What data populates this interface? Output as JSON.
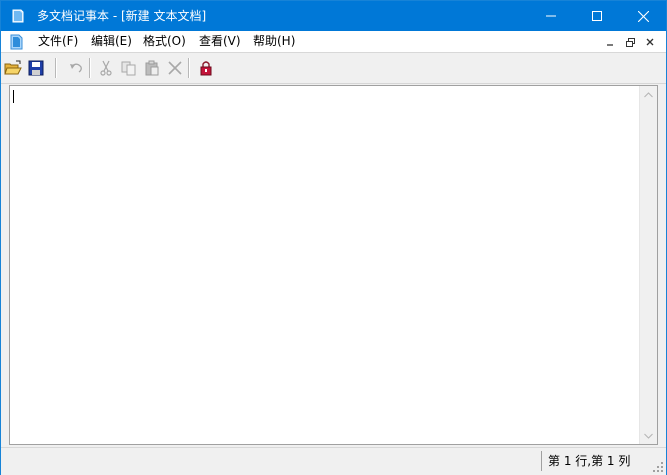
{
  "window": {
    "title": "多文档记事本 - [新建 文本文档]"
  },
  "menu": {
    "items": [
      {
        "label": "文件(F)"
      },
      {
        "label": "编辑(E)"
      },
      {
        "label": "格式(O)"
      },
      {
        "label": "查看(V)"
      },
      {
        "label": "帮助(H)"
      }
    ]
  },
  "toolbar": {
    "buttons": [
      "open-folder-icon",
      "save-icon",
      "undo-icon",
      "cut-icon",
      "copy-icon",
      "paste-icon",
      "delete-icon",
      "lock-icon"
    ]
  },
  "editor": {
    "content": ""
  },
  "status": {
    "position": "第 1 行,第 1 列"
  },
  "colors": {
    "titlebar": "#0078d7",
    "accent": "#1783d7"
  }
}
